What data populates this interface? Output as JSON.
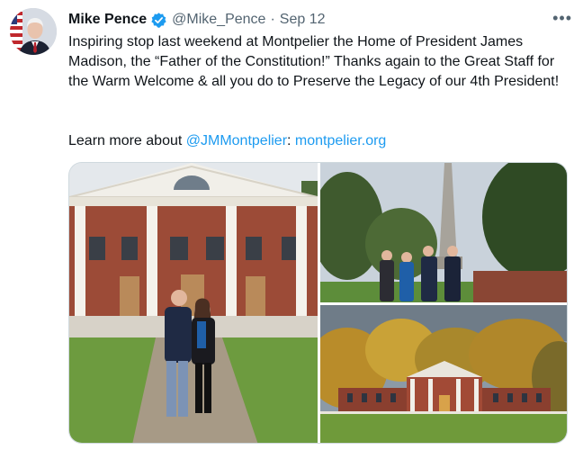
{
  "tweet": {
    "author_name": "Mike Pence",
    "handle": "@Mike_Pence",
    "separator": "·",
    "date": "Sep 12",
    "more_icon": "more-icon",
    "text": "Inspiring stop last weekend at Montpelier the Home of President James Madison, the “Father of the Constitution!” Thanks again to the Great Staff for the Warm Welcome & all you do to Preserve the Legacy of our 4th President!",
    "learn_prefix": "Learn more about ",
    "mention": "@JMMontpelier",
    "colon": ": ",
    "url": "montpelier.org"
  },
  "colors": {
    "link": "#1d9bf0",
    "verified": "#1d9bf0",
    "secondary_text": "#536471"
  },
  "media": {
    "photos": [
      "montpelier-portico-photo",
      "obelisk-group-photo",
      "mansion-autumn-photo"
    ]
  }
}
